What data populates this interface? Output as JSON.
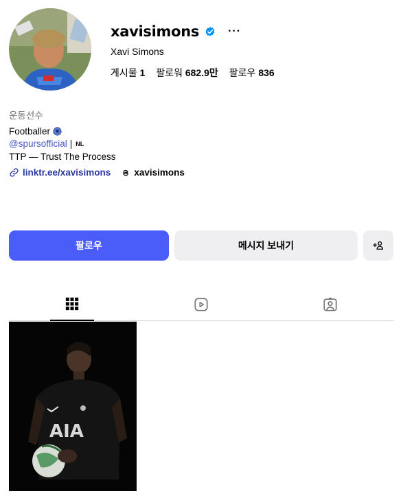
{
  "profile": {
    "username": "xavisimons",
    "full_name": "Xavi Simons",
    "verified": true,
    "more_label": "···",
    "avatar_icon": "profile-photo"
  },
  "stats": {
    "posts_label": "게시물",
    "posts_value": "1",
    "followers_label": "팔로워",
    "followers_value": "682.9만",
    "following_label": "팔로우",
    "following_value": "836"
  },
  "bio": {
    "category": "운동선수",
    "line1": "Footballer",
    "mention": "@spursofficial",
    "separator": "|",
    "flag": "NL",
    "line3": "TTP — Trust The Process",
    "link": "linktr.ee/xavisimons",
    "threads": "xavisimons"
  },
  "actions": {
    "follow": "팔로우",
    "message": "메시지 보내기",
    "suggest_icon": "add-person-icon"
  },
  "tabs": [
    {
      "name": "posts",
      "icon": "grid-icon",
      "active": true
    },
    {
      "name": "reels",
      "icon": "reels-icon",
      "active": false
    },
    {
      "name": "tagged",
      "icon": "tagged-icon",
      "active": false
    }
  ],
  "colors": {
    "accent": "#4a5df9",
    "verified": "#0095f6",
    "link": "#2d3a9e",
    "mention": "#4a57c9"
  },
  "posts": [
    {
      "text_on_shirt": "AIA"
    }
  ]
}
